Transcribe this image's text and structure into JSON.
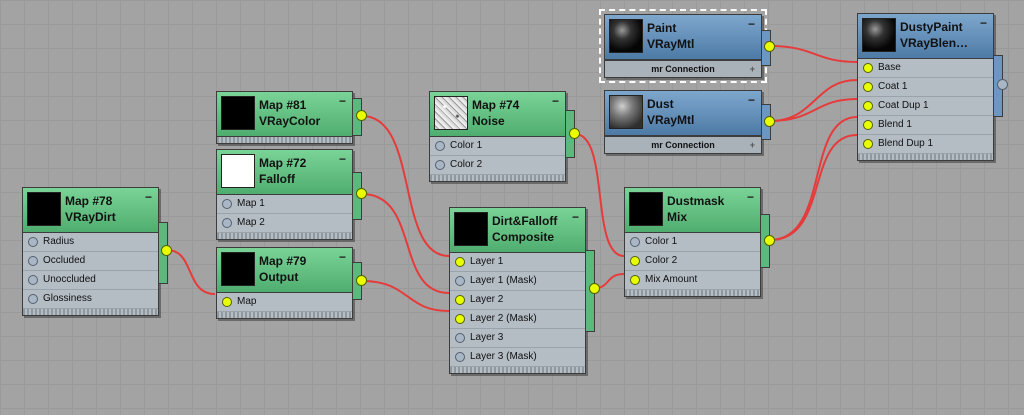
{
  "nodes": {
    "map78": {
      "name": "Map #78",
      "type": "VRayDirt",
      "minimize": "−",
      "inputs": [
        "Radius",
        "Occluded",
        "Unoccluded",
        "Glossiness"
      ]
    },
    "map81": {
      "name": "Map #81",
      "type": "VRayColor",
      "minimize": "−"
    },
    "map72": {
      "name": "Map #72",
      "type": "Falloff",
      "minimize": "−",
      "inputs": [
        "Map 1",
        "Map 2"
      ]
    },
    "map79": {
      "name": "Map #79",
      "type": "Output",
      "minimize": "−",
      "inputs": [
        "Map"
      ]
    },
    "map74": {
      "name": "Map #74",
      "type": "Noise",
      "minimize": "−",
      "inputs": [
        "Color 1",
        "Color 2"
      ]
    },
    "composite": {
      "name": "Dirt&Falloff",
      "type": "Composite",
      "minimize": "−",
      "inputs": [
        "Layer 1",
        "Layer 1 (Mask)",
        "Layer 2",
        "Layer 2 (Mask)",
        "Layer 3",
        "Layer 3 (Mask)"
      ]
    },
    "dustmask": {
      "name": "Dustmask",
      "type": "Mix",
      "minimize": "−",
      "inputs": [
        "Color 1",
        "Color 2",
        "Mix Amount"
      ]
    },
    "paint": {
      "name": "Paint",
      "type": "VRayMtl",
      "minimize": "−",
      "connection": "mr Connection",
      "plus": "+"
    },
    "dust": {
      "name": "Dust",
      "type": "VRayMtl",
      "minimize": "−",
      "connection": "mr Connection",
      "plus": "+"
    },
    "dustypaint": {
      "name": "DustyPaint",
      "type": "VRayBlen…",
      "minimize": "−",
      "inputs": [
        "Base",
        "Coat 1",
        "Coat Dup 1",
        "Blend 1",
        "Blend Dup 1"
      ]
    }
  },
  "colors": {
    "wire": "#e63b3b",
    "socket_connected": "#e8ff00",
    "socket_empty": "#a9b6c6",
    "map_header": "#5fbf80",
    "material_header": "#5f8cb8",
    "selection": "#ffffff"
  },
  "icons": {
    "minimize": "minus-icon",
    "socket": "socket-icon"
  }
}
